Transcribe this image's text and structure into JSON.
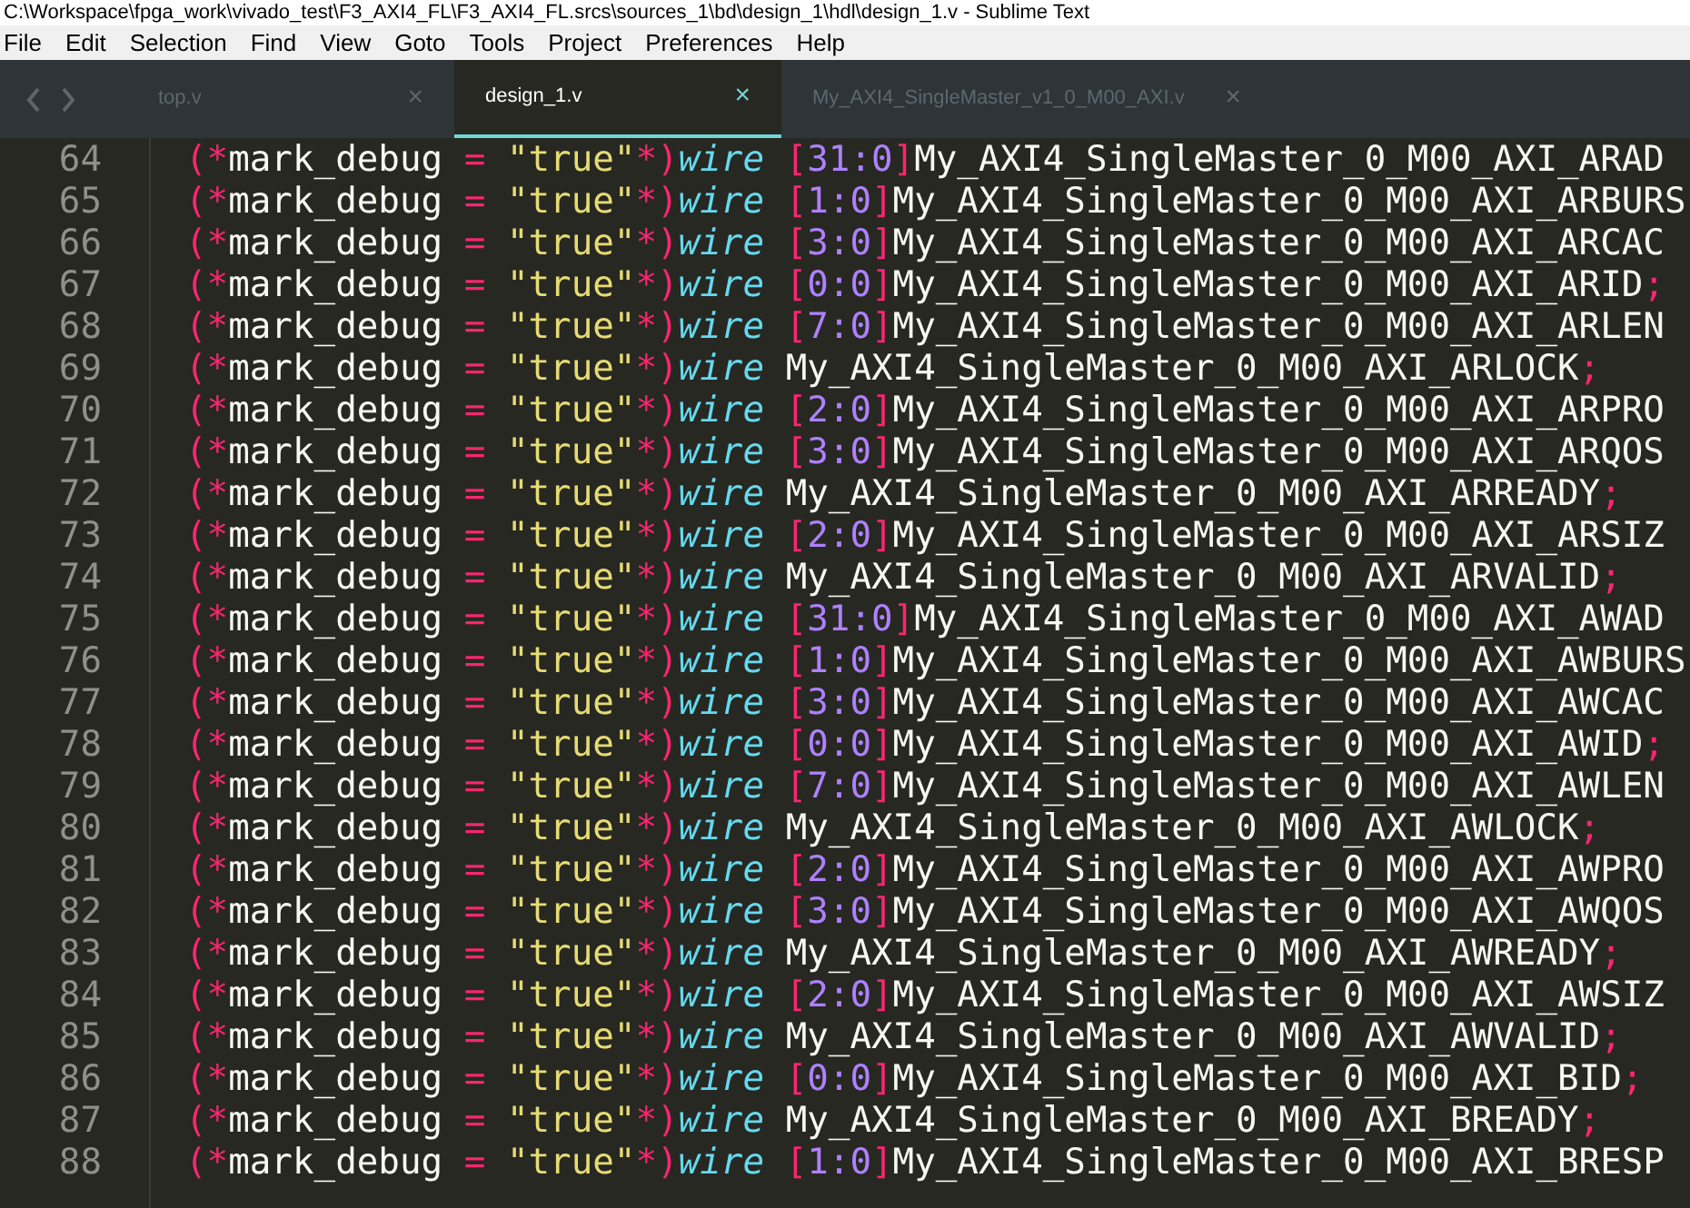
{
  "window": {
    "title": "C:\\Workspace\\fpga_work\\vivado_test\\F3_AXI4_FL\\F3_AXI4_FL.srcs\\sources_1\\bd\\design_1\\hdl\\design_1.v - Sublime Text"
  },
  "menu": [
    "File",
    "Edit",
    "Selection",
    "Find",
    "View",
    "Goto",
    "Tools",
    "Project",
    "Preferences",
    "Help"
  ],
  "tabs": [
    {
      "label": "top.v",
      "close": "×",
      "selected": false
    },
    {
      "label": "design_1.v",
      "close": "×",
      "selected": true
    },
    {
      "label": "My_AXI4_SingleMaster_v1_0_M00_AXI.v",
      "close": "×",
      "selected": false
    }
  ],
  "lines": [
    {
      "number": "64",
      "tokens": [
        {
          "kind": "punct",
          "text": "(*"
        },
        {
          "kind": "plain",
          "text": "mark_debug "
        },
        {
          "kind": "punct",
          "text": "= "
        },
        {
          "kind": "string",
          "text": "\"true\""
        },
        {
          "kind": "punct",
          "text": "*)"
        },
        {
          "kind": "keyword",
          "text": "wire "
        },
        {
          "kind": "punct",
          "text": "["
        },
        {
          "kind": "number",
          "text": "31:0"
        },
        {
          "kind": "punct",
          "text": "]"
        },
        {
          "kind": "plain",
          "text": "My_AXI4_SingleMaster_0_M00_AXI_ARAD"
        }
      ]
    },
    {
      "number": "65",
      "tokens": [
        {
          "kind": "punct",
          "text": "(*"
        },
        {
          "kind": "plain",
          "text": "mark_debug "
        },
        {
          "kind": "punct",
          "text": "= "
        },
        {
          "kind": "string",
          "text": "\"true\""
        },
        {
          "kind": "punct",
          "text": "*)"
        },
        {
          "kind": "keyword",
          "text": "wire "
        },
        {
          "kind": "punct",
          "text": "["
        },
        {
          "kind": "number",
          "text": "1:0"
        },
        {
          "kind": "punct",
          "text": "]"
        },
        {
          "kind": "plain",
          "text": "My_AXI4_SingleMaster_0_M00_AXI_ARBURS"
        }
      ]
    },
    {
      "number": "66",
      "tokens": [
        {
          "kind": "punct",
          "text": "(*"
        },
        {
          "kind": "plain",
          "text": "mark_debug "
        },
        {
          "kind": "punct",
          "text": "= "
        },
        {
          "kind": "string",
          "text": "\"true\""
        },
        {
          "kind": "punct",
          "text": "*)"
        },
        {
          "kind": "keyword",
          "text": "wire "
        },
        {
          "kind": "punct",
          "text": "["
        },
        {
          "kind": "number",
          "text": "3:0"
        },
        {
          "kind": "punct",
          "text": "]"
        },
        {
          "kind": "plain",
          "text": "My_AXI4_SingleMaster_0_M00_AXI_ARCAC"
        }
      ]
    },
    {
      "number": "67",
      "tokens": [
        {
          "kind": "punct",
          "text": "(*"
        },
        {
          "kind": "plain",
          "text": "mark_debug "
        },
        {
          "kind": "punct",
          "text": "= "
        },
        {
          "kind": "string",
          "text": "\"true\""
        },
        {
          "kind": "punct",
          "text": "*)"
        },
        {
          "kind": "keyword",
          "text": "wire "
        },
        {
          "kind": "punct",
          "text": "["
        },
        {
          "kind": "number",
          "text": "0:0"
        },
        {
          "kind": "punct",
          "text": "]"
        },
        {
          "kind": "plain",
          "text": "My_AXI4_SingleMaster_0_M00_AXI_ARID"
        },
        {
          "kind": "punct",
          "text": ";"
        }
      ]
    },
    {
      "number": "68",
      "tokens": [
        {
          "kind": "punct",
          "text": "(*"
        },
        {
          "kind": "plain",
          "text": "mark_debug "
        },
        {
          "kind": "punct",
          "text": "= "
        },
        {
          "kind": "string",
          "text": "\"true\""
        },
        {
          "kind": "punct",
          "text": "*)"
        },
        {
          "kind": "keyword",
          "text": "wire "
        },
        {
          "kind": "punct",
          "text": "["
        },
        {
          "kind": "number",
          "text": "7:0"
        },
        {
          "kind": "punct",
          "text": "]"
        },
        {
          "kind": "plain",
          "text": "My_AXI4_SingleMaster_0_M00_AXI_ARLEN"
        }
      ]
    },
    {
      "number": "69",
      "tokens": [
        {
          "kind": "punct",
          "text": "(*"
        },
        {
          "kind": "plain",
          "text": "mark_debug "
        },
        {
          "kind": "punct",
          "text": "= "
        },
        {
          "kind": "string",
          "text": "\"true\""
        },
        {
          "kind": "punct",
          "text": "*)"
        },
        {
          "kind": "keyword",
          "text": "wire "
        },
        {
          "kind": "plain",
          "text": "My_AXI4_SingleMaster_0_M00_AXI_ARLOCK"
        },
        {
          "kind": "punct",
          "text": ";"
        }
      ]
    },
    {
      "number": "70",
      "tokens": [
        {
          "kind": "punct",
          "text": "(*"
        },
        {
          "kind": "plain",
          "text": "mark_debug "
        },
        {
          "kind": "punct",
          "text": "= "
        },
        {
          "kind": "string",
          "text": "\"true\""
        },
        {
          "kind": "punct",
          "text": "*)"
        },
        {
          "kind": "keyword",
          "text": "wire "
        },
        {
          "kind": "punct",
          "text": "["
        },
        {
          "kind": "number",
          "text": "2:0"
        },
        {
          "kind": "punct",
          "text": "]"
        },
        {
          "kind": "plain",
          "text": "My_AXI4_SingleMaster_0_M00_AXI_ARPRO"
        }
      ]
    },
    {
      "number": "71",
      "tokens": [
        {
          "kind": "punct",
          "text": "(*"
        },
        {
          "kind": "plain",
          "text": "mark_debug "
        },
        {
          "kind": "punct",
          "text": "= "
        },
        {
          "kind": "string",
          "text": "\"true\""
        },
        {
          "kind": "punct",
          "text": "*)"
        },
        {
          "kind": "keyword",
          "text": "wire "
        },
        {
          "kind": "punct",
          "text": "["
        },
        {
          "kind": "number",
          "text": "3:0"
        },
        {
          "kind": "punct",
          "text": "]"
        },
        {
          "kind": "plain",
          "text": "My_AXI4_SingleMaster_0_M00_AXI_ARQOS"
        }
      ]
    },
    {
      "number": "72",
      "tokens": [
        {
          "kind": "punct",
          "text": "(*"
        },
        {
          "kind": "plain",
          "text": "mark_debug "
        },
        {
          "kind": "punct",
          "text": "= "
        },
        {
          "kind": "string",
          "text": "\"true\""
        },
        {
          "kind": "punct",
          "text": "*)"
        },
        {
          "kind": "keyword",
          "text": "wire "
        },
        {
          "kind": "plain",
          "text": "My_AXI4_SingleMaster_0_M00_AXI_ARREADY"
        },
        {
          "kind": "punct",
          "text": ";"
        }
      ]
    },
    {
      "number": "73",
      "tokens": [
        {
          "kind": "punct",
          "text": "(*"
        },
        {
          "kind": "plain",
          "text": "mark_debug "
        },
        {
          "kind": "punct",
          "text": "= "
        },
        {
          "kind": "string",
          "text": "\"true\""
        },
        {
          "kind": "punct",
          "text": "*)"
        },
        {
          "kind": "keyword",
          "text": "wire "
        },
        {
          "kind": "punct",
          "text": "["
        },
        {
          "kind": "number",
          "text": "2:0"
        },
        {
          "kind": "punct",
          "text": "]"
        },
        {
          "kind": "plain",
          "text": "My_AXI4_SingleMaster_0_M00_AXI_ARSIZ"
        }
      ]
    },
    {
      "number": "74",
      "tokens": [
        {
          "kind": "punct",
          "text": "(*"
        },
        {
          "kind": "plain",
          "text": "mark_debug "
        },
        {
          "kind": "punct",
          "text": "= "
        },
        {
          "kind": "string",
          "text": "\"true\""
        },
        {
          "kind": "punct",
          "text": "*)"
        },
        {
          "kind": "keyword",
          "text": "wire "
        },
        {
          "kind": "plain",
          "text": "My_AXI4_SingleMaster_0_M00_AXI_ARVALID"
        },
        {
          "kind": "punct",
          "text": ";"
        }
      ]
    },
    {
      "number": "75",
      "tokens": [
        {
          "kind": "punct",
          "text": "(*"
        },
        {
          "kind": "plain",
          "text": "mark_debug "
        },
        {
          "kind": "punct",
          "text": "= "
        },
        {
          "kind": "string",
          "text": "\"true\""
        },
        {
          "kind": "punct",
          "text": "*)"
        },
        {
          "kind": "keyword",
          "text": "wire "
        },
        {
          "kind": "punct",
          "text": "["
        },
        {
          "kind": "number",
          "text": "31:0"
        },
        {
          "kind": "punct",
          "text": "]"
        },
        {
          "kind": "plain",
          "text": "My_AXI4_SingleMaster_0_M00_AXI_AWAD"
        }
      ]
    },
    {
      "number": "76",
      "tokens": [
        {
          "kind": "punct",
          "text": "(*"
        },
        {
          "kind": "plain",
          "text": "mark_debug "
        },
        {
          "kind": "punct",
          "text": "= "
        },
        {
          "kind": "string",
          "text": "\"true\""
        },
        {
          "kind": "punct",
          "text": "*)"
        },
        {
          "kind": "keyword",
          "text": "wire "
        },
        {
          "kind": "punct",
          "text": "["
        },
        {
          "kind": "number",
          "text": "1:0"
        },
        {
          "kind": "punct",
          "text": "]"
        },
        {
          "kind": "plain",
          "text": "My_AXI4_SingleMaster_0_M00_AXI_AWBURS"
        }
      ]
    },
    {
      "number": "77",
      "tokens": [
        {
          "kind": "punct",
          "text": "(*"
        },
        {
          "kind": "plain",
          "text": "mark_debug "
        },
        {
          "kind": "punct",
          "text": "= "
        },
        {
          "kind": "string",
          "text": "\"true\""
        },
        {
          "kind": "punct",
          "text": "*)"
        },
        {
          "kind": "keyword",
          "text": "wire "
        },
        {
          "kind": "punct",
          "text": "["
        },
        {
          "kind": "number",
          "text": "3:0"
        },
        {
          "kind": "punct",
          "text": "]"
        },
        {
          "kind": "plain",
          "text": "My_AXI4_SingleMaster_0_M00_AXI_AWCAC"
        }
      ]
    },
    {
      "number": "78",
      "tokens": [
        {
          "kind": "punct",
          "text": "(*"
        },
        {
          "kind": "plain",
          "text": "mark_debug "
        },
        {
          "kind": "punct",
          "text": "= "
        },
        {
          "kind": "string",
          "text": "\"true\""
        },
        {
          "kind": "punct",
          "text": "*)"
        },
        {
          "kind": "keyword",
          "text": "wire "
        },
        {
          "kind": "punct",
          "text": "["
        },
        {
          "kind": "number",
          "text": "0:0"
        },
        {
          "kind": "punct",
          "text": "]"
        },
        {
          "kind": "plain",
          "text": "My_AXI4_SingleMaster_0_M00_AXI_AWID"
        },
        {
          "kind": "punct",
          "text": ";"
        }
      ]
    },
    {
      "number": "79",
      "tokens": [
        {
          "kind": "punct",
          "text": "(*"
        },
        {
          "kind": "plain",
          "text": "mark_debug "
        },
        {
          "kind": "punct",
          "text": "= "
        },
        {
          "kind": "string",
          "text": "\"true\""
        },
        {
          "kind": "punct",
          "text": "*)"
        },
        {
          "kind": "keyword",
          "text": "wire "
        },
        {
          "kind": "punct",
          "text": "["
        },
        {
          "kind": "number",
          "text": "7:0"
        },
        {
          "kind": "punct",
          "text": "]"
        },
        {
          "kind": "plain",
          "text": "My_AXI4_SingleMaster_0_M00_AXI_AWLEN"
        }
      ]
    },
    {
      "number": "80",
      "tokens": [
        {
          "kind": "punct",
          "text": "(*"
        },
        {
          "kind": "plain",
          "text": "mark_debug "
        },
        {
          "kind": "punct",
          "text": "= "
        },
        {
          "kind": "string",
          "text": "\"true\""
        },
        {
          "kind": "punct",
          "text": "*)"
        },
        {
          "kind": "keyword",
          "text": "wire "
        },
        {
          "kind": "plain",
          "text": "My_AXI4_SingleMaster_0_M00_AXI_AWLOCK"
        },
        {
          "kind": "punct",
          "text": ";"
        }
      ]
    },
    {
      "number": "81",
      "tokens": [
        {
          "kind": "punct",
          "text": "(*"
        },
        {
          "kind": "plain",
          "text": "mark_debug "
        },
        {
          "kind": "punct",
          "text": "= "
        },
        {
          "kind": "string",
          "text": "\"true\""
        },
        {
          "kind": "punct",
          "text": "*)"
        },
        {
          "kind": "keyword",
          "text": "wire "
        },
        {
          "kind": "punct",
          "text": "["
        },
        {
          "kind": "number",
          "text": "2:0"
        },
        {
          "kind": "punct",
          "text": "]"
        },
        {
          "kind": "plain",
          "text": "My_AXI4_SingleMaster_0_M00_AXI_AWPRO"
        }
      ]
    },
    {
      "number": "82",
      "tokens": [
        {
          "kind": "punct",
          "text": "(*"
        },
        {
          "kind": "plain",
          "text": "mark_debug "
        },
        {
          "kind": "punct",
          "text": "= "
        },
        {
          "kind": "string",
          "text": "\"true\""
        },
        {
          "kind": "punct",
          "text": "*)"
        },
        {
          "kind": "keyword",
          "text": "wire "
        },
        {
          "kind": "punct",
          "text": "["
        },
        {
          "kind": "number",
          "text": "3:0"
        },
        {
          "kind": "punct",
          "text": "]"
        },
        {
          "kind": "plain",
          "text": "My_AXI4_SingleMaster_0_M00_AXI_AWQOS"
        }
      ]
    },
    {
      "number": "83",
      "tokens": [
        {
          "kind": "punct",
          "text": "(*"
        },
        {
          "kind": "plain",
          "text": "mark_debug "
        },
        {
          "kind": "punct",
          "text": "= "
        },
        {
          "kind": "string",
          "text": "\"true\""
        },
        {
          "kind": "punct",
          "text": "*)"
        },
        {
          "kind": "keyword",
          "text": "wire "
        },
        {
          "kind": "plain",
          "text": "My_AXI4_SingleMaster_0_M00_AXI_AWREADY"
        },
        {
          "kind": "punct",
          "text": ";"
        }
      ]
    },
    {
      "number": "84",
      "tokens": [
        {
          "kind": "punct",
          "text": "(*"
        },
        {
          "kind": "plain",
          "text": "mark_debug "
        },
        {
          "kind": "punct",
          "text": "= "
        },
        {
          "kind": "string",
          "text": "\"true\""
        },
        {
          "kind": "punct",
          "text": "*)"
        },
        {
          "kind": "keyword",
          "text": "wire "
        },
        {
          "kind": "punct",
          "text": "["
        },
        {
          "kind": "number",
          "text": "2:0"
        },
        {
          "kind": "punct",
          "text": "]"
        },
        {
          "kind": "plain",
          "text": "My_AXI4_SingleMaster_0_M00_AXI_AWSIZ"
        }
      ]
    },
    {
      "number": "85",
      "tokens": [
        {
          "kind": "punct",
          "text": "(*"
        },
        {
          "kind": "plain",
          "text": "mark_debug "
        },
        {
          "kind": "punct",
          "text": "= "
        },
        {
          "kind": "string",
          "text": "\"true\""
        },
        {
          "kind": "punct",
          "text": "*)"
        },
        {
          "kind": "keyword",
          "text": "wire "
        },
        {
          "kind": "plain",
          "text": "My_AXI4_SingleMaster_0_M00_AXI_AWVALID"
        },
        {
          "kind": "punct",
          "text": ";"
        }
      ]
    },
    {
      "number": "86",
      "tokens": [
        {
          "kind": "punct",
          "text": "(*"
        },
        {
          "kind": "plain",
          "text": "mark_debug "
        },
        {
          "kind": "punct",
          "text": "= "
        },
        {
          "kind": "string",
          "text": "\"true\""
        },
        {
          "kind": "punct",
          "text": "*)"
        },
        {
          "kind": "keyword",
          "text": "wire "
        },
        {
          "kind": "punct",
          "text": "["
        },
        {
          "kind": "number",
          "text": "0:0"
        },
        {
          "kind": "punct",
          "text": "]"
        },
        {
          "kind": "plain",
          "text": "My_AXI4_SingleMaster_0_M00_AXI_BID"
        },
        {
          "kind": "punct",
          "text": ";"
        }
      ]
    },
    {
      "number": "87",
      "tokens": [
        {
          "kind": "punct",
          "text": "(*"
        },
        {
          "kind": "plain",
          "text": "mark_debug "
        },
        {
          "kind": "punct",
          "text": "= "
        },
        {
          "kind": "string",
          "text": "\"true\""
        },
        {
          "kind": "punct",
          "text": "*)"
        },
        {
          "kind": "keyword",
          "text": "wire "
        },
        {
          "kind": "plain",
          "text": "My_AXI4_SingleMaster_0_M00_AXI_BREADY"
        },
        {
          "kind": "punct",
          "text": ";"
        }
      ]
    },
    {
      "number": "88",
      "tokens": [
        {
          "kind": "punct",
          "text": "(*"
        },
        {
          "kind": "plain",
          "text": "mark_debug "
        },
        {
          "kind": "punct",
          "text": "= "
        },
        {
          "kind": "string",
          "text": "\"true\""
        },
        {
          "kind": "punct",
          "text": "*)"
        },
        {
          "kind": "keyword",
          "text": "wire "
        },
        {
          "kind": "punct",
          "text": "["
        },
        {
          "kind": "number",
          "text": "1:0"
        },
        {
          "kind": "punct",
          "text": "]"
        },
        {
          "kind": "plain",
          "text": "My_AXI4_SingleMaster_0_M00_AXI_BRESP"
        }
      ]
    }
  ]
}
